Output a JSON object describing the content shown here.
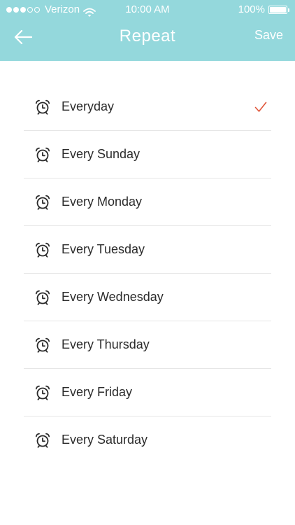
{
  "status_bar": {
    "signal_filled": 3,
    "signal_total": 5,
    "carrier": "Verizon",
    "time": "10:00 AM",
    "battery": "100%",
    "battery_level": 1.0
  },
  "nav": {
    "back_icon": "arrow-left-icon",
    "title": "Repeat",
    "save_label": "Save"
  },
  "repeat_options": [
    {
      "label": "Everyday",
      "icon": "alarm-clock-icon",
      "selected": true
    },
    {
      "label": "Every Sunday",
      "icon": "alarm-clock-icon",
      "selected": false
    },
    {
      "label": "Every Monday",
      "icon": "alarm-clock-icon",
      "selected": false
    },
    {
      "label": "Every Tuesday",
      "icon": "alarm-clock-icon",
      "selected": false
    },
    {
      "label": "Every Wednesday",
      "icon": "alarm-clock-icon",
      "selected": false
    },
    {
      "label": "Every Thursday",
      "icon": "alarm-clock-icon",
      "selected": false
    },
    {
      "label": "Every Friday",
      "icon": "alarm-clock-icon",
      "selected": false
    },
    {
      "label": "Every Saturday",
      "icon": "alarm-clock-icon",
      "selected": false
    }
  ],
  "colors": {
    "header_bg": "#94d8dc",
    "header_text": "#ffffff",
    "check_color": "#e0563a",
    "text_color": "#2b2b2b"
  }
}
